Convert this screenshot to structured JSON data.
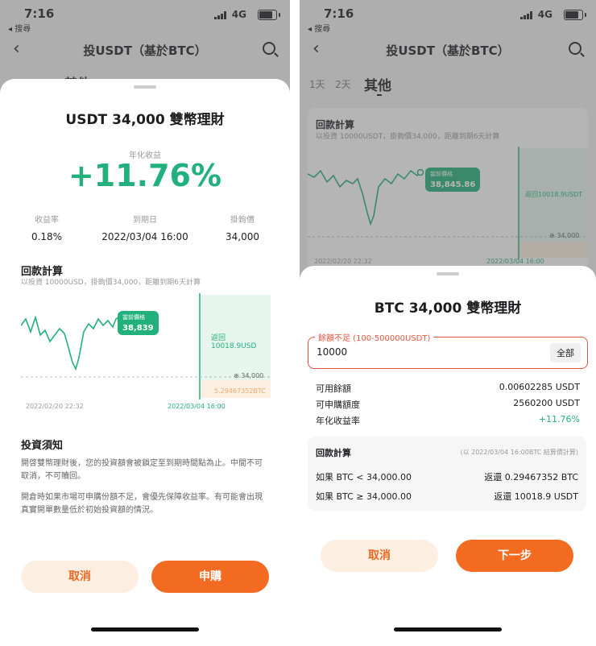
{
  "status": {
    "time": "7:16",
    "back_app": "◂ 搜尋",
    "network": "4G"
  },
  "nav": {
    "title": "投USDT（基於BTC）"
  },
  "left_bg": {
    "tab_peek": "其他"
  },
  "left_sheet": {
    "title": "USDT 34,000 雙幣理財",
    "annual_label": "年化收益",
    "annual_value": "+11.76%",
    "stats": [
      {
        "label": "收益率",
        "value": "0.18%"
      },
      {
        "label": "到期日",
        "value": "2022/03/04 16:00"
      },
      {
        "label": "掛鉤價",
        "value": "34,000"
      }
    ],
    "calc_title": "回款計算",
    "calc_sub": "以投資 10000USD，掛鉤價34,000，距離到期6天計算",
    "chip_label": "當前價格",
    "chip_value": "38,839",
    "return_label": "返回10018.9USD",
    "strike_label": "34,000",
    "convert_label": "5.29467352BTC",
    "date_start": "2022/02/20 22:32",
    "date_end": "2022/03/04 16:00",
    "notice_title": "投資須知",
    "notice_p1": "開啓雙幣理財後，您的投資額會被鎖定至到期時間點為止。中間不可取消，不可贖回。",
    "notice_p2": "開倉時如果市場可申購份額不足，會優先保障收益率。有可能會出現真實開單數量低於初始投資額的情況。",
    "cancel": "取消",
    "confirm": "申購"
  },
  "right_bg": {
    "tabs": [
      "1天",
      "2天",
      "其他"
    ],
    "calc_title": "回款計算",
    "calc_sub": "以投資 10000USDT，掛鉤價34,000，距離到期6天計算",
    "chip_label": "當前價格",
    "chip_value": "38,845.86",
    "return_label": "返回10018.9USDT",
    "strike_label": "34,000",
    "date_start": "2022/02/20 22:32",
    "date_end": "2022/03/04 16:00"
  },
  "right_sheet": {
    "title": "BTC 34,000 雙幣理財",
    "field_label": "餘額不足 (100-500000USDT)",
    "field_value": "10000",
    "all_button": "全部",
    "rows": [
      {
        "label": "可用餘額",
        "value": "0.00602285 USDT"
      },
      {
        "label": "可申購額度",
        "value": "2560200 USDT"
      },
      {
        "label": "年化收益率",
        "value": "+11.76%"
      }
    ],
    "calc_title": "回款計算",
    "calc_note": "(以 2022/03/04 16:00BTC 結算價計算)",
    "calc_rows": [
      {
        "label": "如果 BTC < 34,000.00",
        "value": "返還 0.29467352 BTC"
      },
      {
        "label": "如果 BTC ≥ 34,000.00",
        "value": "返還 10018.9 USDT"
      }
    ],
    "cancel": "取消",
    "next": "下一步"
  },
  "colors": {
    "accent": "#f26b21",
    "green": "#22b07d",
    "red": "#e8553f"
  },
  "icons": [
    "back-arrow-icon",
    "search-icon",
    "signal-icon",
    "battery-icon",
    "chart-current-price-icon"
  ]
}
